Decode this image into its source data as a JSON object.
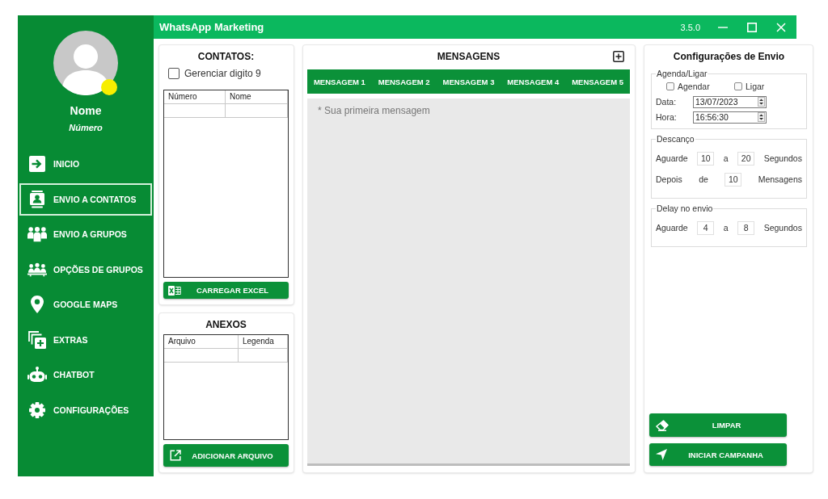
{
  "window": {
    "title": "WhatsApp Marketing",
    "version": "3.5.0"
  },
  "sidebar": {
    "profile": {
      "name": "Nome",
      "number": "Número"
    },
    "items": [
      {
        "label": "INICIO",
        "selected": false
      },
      {
        "label": "ENVIO A CONTATOS",
        "selected": true
      },
      {
        "label": "ENVIO A GRUPOS",
        "selected": false
      },
      {
        "label": "OPÇÕES DE GRUPOS",
        "selected": false
      },
      {
        "label": "GOOGLE MAPS",
        "selected": false
      },
      {
        "label": "EXTRAS",
        "selected": false
      },
      {
        "label": "CHATBOT",
        "selected": false
      },
      {
        "label": "CONFIGURAÇÕES",
        "selected": false
      }
    ]
  },
  "contacts": {
    "title": "CONTATOS:",
    "option": {
      "label": "Gerenciar digito 9",
      "checked": false
    },
    "table": {
      "columns": [
        "Número",
        "Nome"
      ]
    },
    "button": "CARREGAR EXCEL"
  },
  "attachments": {
    "title": "ANEXOS",
    "table": {
      "columns": [
        "Arquivo",
        "Legenda"
      ]
    },
    "button": "ADICIONAR ARQUIVO"
  },
  "messages": {
    "title": "MENSAGENS",
    "tabs": [
      "MENSAGEM 1",
      "MENSAGEM 2",
      "MENSAGEM 3",
      "MENSAGEM 4",
      "MENSAGEM 5"
    ],
    "editor": {
      "placeholder": "* Sua primeira mensagem"
    }
  },
  "settings": {
    "title": "Configurações de Envio",
    "schedule": {
      "legend": "Agenda/Ligar",
      "options": [
        {
          "label": "Agendar",
          "checked": false
        },
        {
          "label": "Ligar",
          "checked": false
        }
      ],
      "fields": [
        {
          "label": "Data:",
          "value": "13/07/2023"
        },
        {
          "label": "Hora:",
          "value": "16:56:30"
        }
      ]
    },
    "groups": [
      {
        "legend": "Descanço",
        "rows": [
          {
            "kind": "range",
            "label": "Aguarde",
            "min": "10",
            "joiner": "a",
            "max": "20",
            "unit": "Segundos"
          },
          {
            "kind": "count",
            "label": "Depois",
            "joiner": "de",
            "value": "10",
            "unit": "Mensagens"
          }
        ]
      },
      {
        "legend": "Delay no envio",
        "rows": [
          {
            "kind": "range",
            "label": "Aguarde",
            "min": "4",
            "joiner": "a",
            "max": "8",
            "unit": "Segundos"
          }
        ]
      }
    ],
    "buttons": [
      "LIMPAR",
      "INICIAR CAMPANHA"
    ]
  }
}
